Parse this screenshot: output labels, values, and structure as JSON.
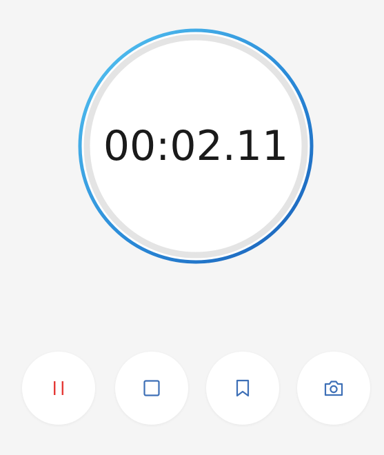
{
  "stopwatch": {
    "elapsed": "00:02.11"
  },
  "controls": [
    {
      "name": "pause-button",
      "icon": "pause-icon",
      "color": "#e53935"
    },
    {
      "name": "stop-button",
      "icon": "stop-icon",
      "color": "#3d6fb6"
    },
    {
      "name": "lap-button",
      "icon": "bookmark-icon",
      "color": "#3d6fb6"
    },
    {
      "name": "screenshot-button",
      "icon": "camera-icon",
      "color": "#3d6fb6"
    }
  ],
  "colors": {
    "background": "#f5f5f5",
    "ring_track": "#e6e6e6",
    "ring_accent_start": "#4fc3f7",
    "ring_accent_end": "#1565c0",
    "text": "#1a1a1a"
  }
}
